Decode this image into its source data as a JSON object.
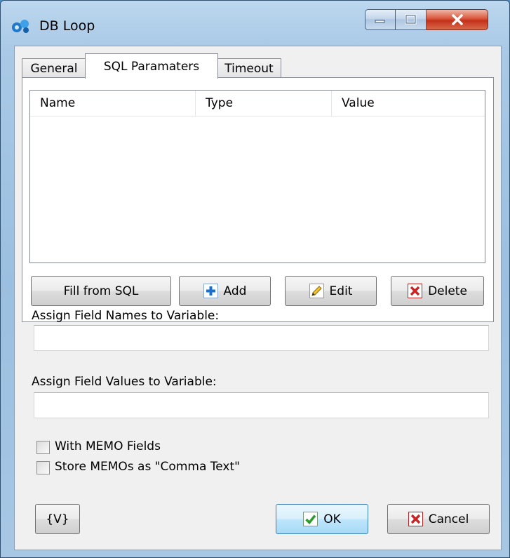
{
  "window": {
    "title": "DB Loop",
    "icon": "db-loop-app-icon"
  },
  "tabs": [
    {
      "label": "General",
      "active": false
    },
    {
      "label": "SQL Paramaters",
      "active": true
    },
    {
      "label": "Timeout",
      "active": false
    }
  ],
  "params_table": {
    "columns": [
      "Name",
      "Type",
      "Value"
    ],
    "rows": []
  },
  "param_buttons": {
    "fill": "Fill from SQL",
    "add": "Add",
    "edit": "Edit",
    "delete": "Delete"
  },
  "field_names": {
    "label": "Assign Field Names to Variable:",
    "value": ""
  },
  "field_values": {
    "label": "Assign Field Values to Variable:",
    "value": ""
  },
  "checkboxes": [
    {
      "label": "With MEMO Fields",
      "checked": false
    },
    {
      "label": "Store MEMOs as \"Comma Text\"",
      "checked": false
    }
  ],
  "footer": {
    "variables": "{V}",
    "ok": "OK",
    "cancel": "Cancel"
  },
  "colors": {
    "add_icon": "#1a6fcf",
    "delete_icon": "#d42020",
    "ok_icon": "#2d9a2d"
  }
}
